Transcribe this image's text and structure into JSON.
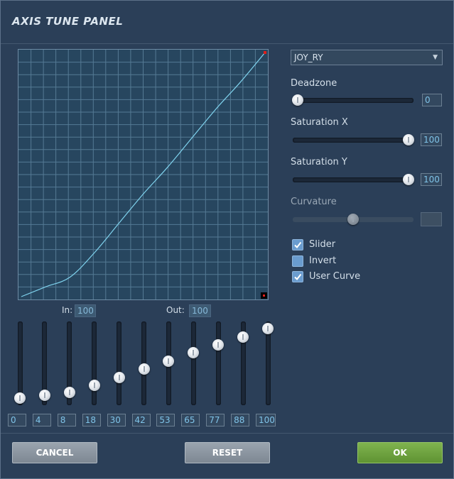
{
  "title": "AXIS TUNE PANEL",
  "in_label": "In:",
  "in_value": "100",
  "out_label": "Out:",
  "out_value": "100",
  "curve_points": [
    0,
    4,
    8,
    18,
    30,
    42,
    53,
    65,
    77,
    88,
    100
  ],
  "point_values": [
    "0",
    "4",
    "8",
    "18",
    "30",
    "42",
    "53",
    "65",
    "77",
    "88",
    "100"
  ],
  "axis_select": "JOY_RY",
  "deadzone": {
    "label": "Deadzone",
    "value": "0",
    "level": 0
  },
  "saturation_x": {
    "label": "Saturation X",
    "value": "100",
    "level": 100
  },
  "saturation_y": {
    "label": "Saturation Y",
    "value": "100",
    "level": 100
  },
  "curvature": {
    "label": "Curvature",
    "value": "",
    "level": 50
  },
  "checkboxes": [
    {
      "label": "Slider",
      "checked": true
    },
    {
      "label": "Invert",
      "checked": false
    },
    {
      "label": "User Curve",
      "checked": true
    }
  ],
  "buttons": {
    "cancel": "CANCEL",
    "reset": "RESET",
    "ok": "OK"
  },
  "colors": {
    "ok": "#6aa33c",
    "curve": "#7fd3ee",
    "accent": "#7fc3e8"
  }
}
